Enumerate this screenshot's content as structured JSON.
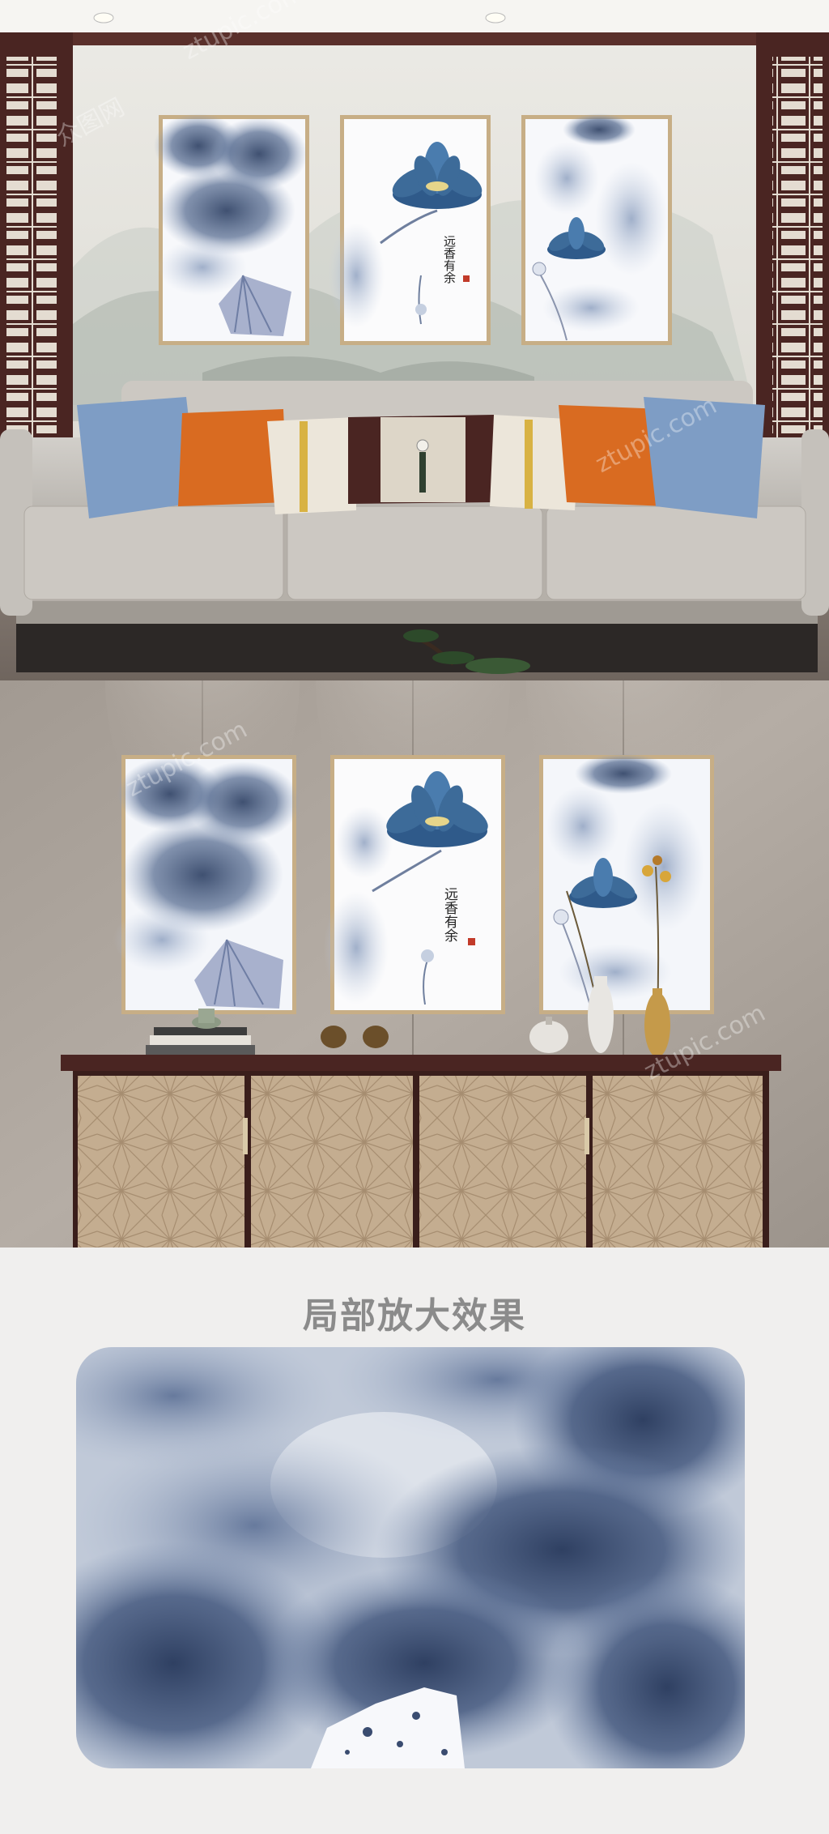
{
  "scene_top": {
    "calligraphy": "远香有余"
  },
  "scene_middle": {
    "calligraphy": "远香有余"
  },
  "detail_section": {
    "heading": "局部放大效果"
  },
  "watermarks": {
    "cn": "众图网",
    "en": "ztupic.com"
  },
  "colors": {
    "ink_blue": "#3e5578",
    "lotus_blue": "#3d6b99",
    "sofa_gray": "#c9c6c1",
    "orange_pillow": "#d96b21",
    "blue_pillow": "#7e9dc5",
    "dark_wood": "#4a2522",
    "frame_wood": "#c7ae86",
    "caption_gray": "#8b8b8b"
  }
}
